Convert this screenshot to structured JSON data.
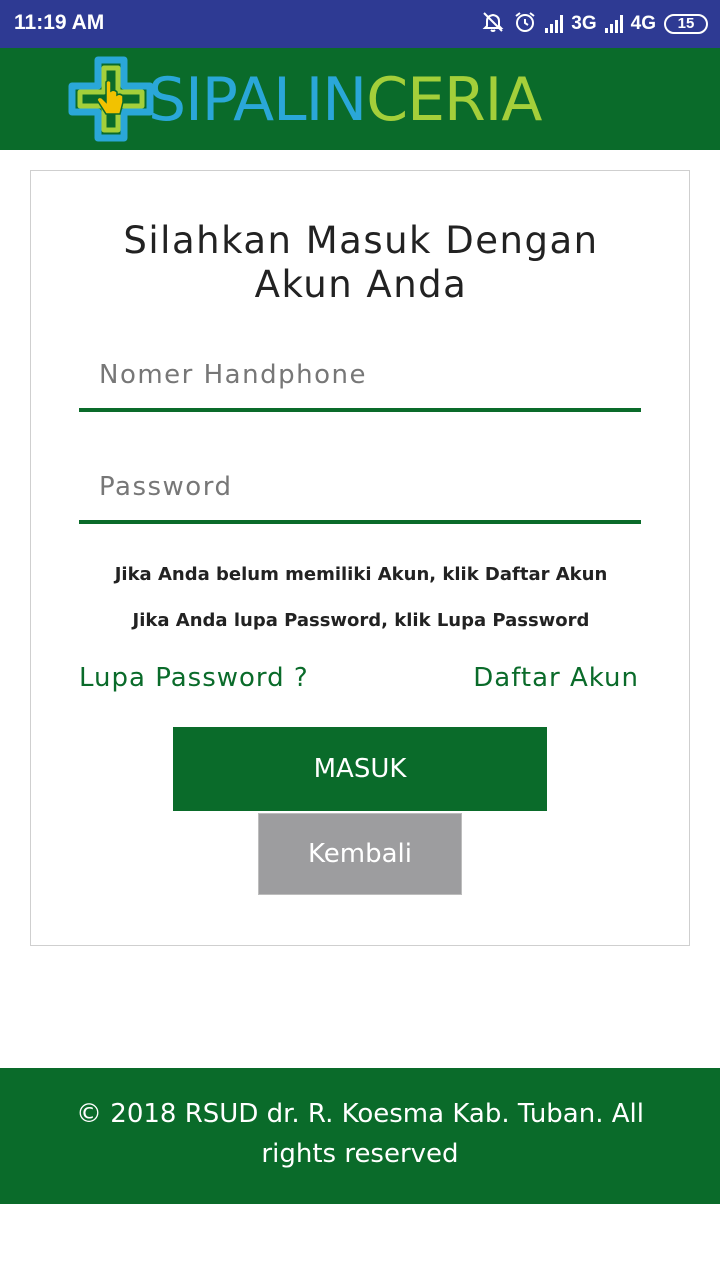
{
  "status_bar": {
    "time": "11:19 AM",
    "network1": "3G",
    "network2": "4G",
    "battery": "15",
    "icons": [
      "mute-icon",
      "alarm-icon",
      "signal-icon",
      "signal-icon",
      "battery-icon"
    ]
  },
  "header": {
    "logo_part1": "SIPALIN",
    "logo_part2": "CERIA",
    "logo_icon": "medical-cross-hand-icon",
    "colors": {
      "bar": "#0a6b2a",
      "logo_blue": "#2aa7d8",
      "logo_green": "#a4cf3a"
    }
  },
  "login": {
    "title": "Silahkan Masuk Dengan Akun Anda",
    "phone_placeholder": "Nomer Handphone",
    "phone_value": "",
    "password_placeholder": "Password",
    "password_value": "",
    "info_register": "Jika Anda belum memiliki Akun, klik Daftar Akun",
    "info_forgot": "Jika Anda lupa Password, klik Lupa Password",
    "forgot_link": "Lupa Password ?",
    "register_link": "Daftar Akun",
    "login_button": "MASUK",
    "back_button": "Kembali"
  },
  "footer": {
    "text": "© 2018 RSUD dr. R. Koesma Kab. Tuban. All rights reserved"
  }
}
